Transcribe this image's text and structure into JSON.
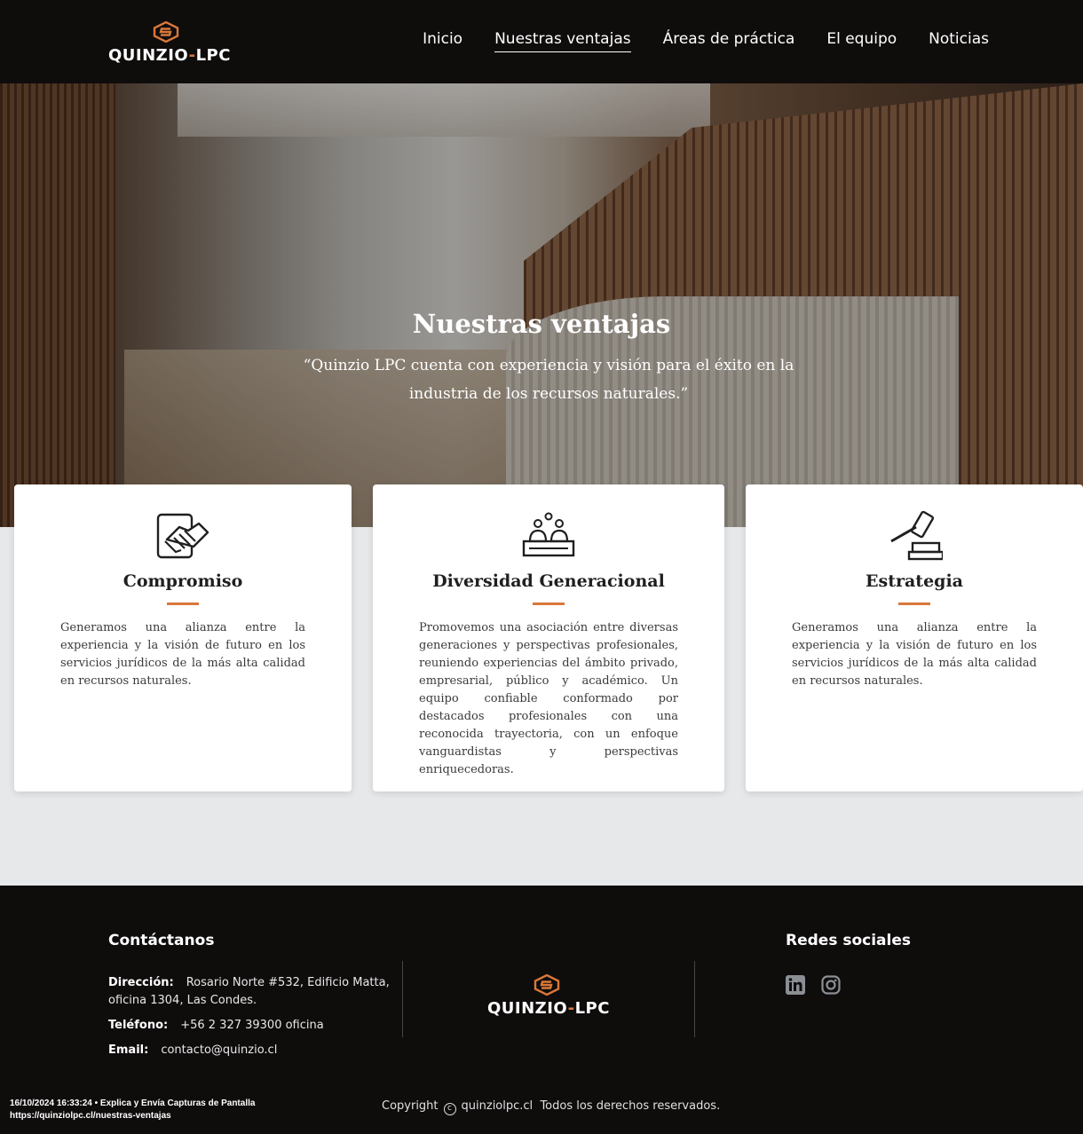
{
  "header": {
    "logo": {
      "brand": "QUINZIO",
      "separator": "-",
      "suffix": "LPC"
    },
    "nav": [
      "Inicio",
      "Nuestras ventajas",
      "Áreas de práctica",
      "El equipo",
      "Noticias"
    ],
    "active_index": 1
  },
  "hero": {
    "title": "Nuestras ventajas",
    "quote": "“Quinzio LPC cuenta con experiencia y visión para el éxito en la industria de los recursos naturales.”"
  },
  "cards": [
    {
      "icon": "handshake-icon",
      "title": "Compromiso",
      "text": "Generamos una alianza entre la experiencia y la visión de futuro en los servicios jurídicos de la más alta calidad en recursos naturales."
    },
    {
      "icon": "team-icon",
      "title": "Diversidad Generacional",
      "text": "Promovemos una asociación entre diversas generaciones y perspectivas profesionales, reuniendo experiencias del ámbito privado, empresarial, público y académico. Un equipo confiable conformado por destacados profesionales con una reconocida trayectoria, con un enfoque vanguardistas y perspectivas enriquecedoras."
    },
    {
      "icon": "gavel-icon",
      "title": "Estrategia",
      "text": "Generamos una alianza entre la experiencia y la visión de futuro en los servicios jurídicos de la más alta calidad en recursos naturales."
    }
  ],
  "footer": {
    "contact_title": "Contáctanos",
    "address_label": "Dirección:",
    "address_value": "Rosario Norte #532, Edificio Matta, oficina 1304, Las Condes.",
    "phone_label": "Teléfono:",
    "phone_value": "+56 2 327 39300 oficina",
    "email_label": "Email:",
    "email_value": "contacto@quinzio.cl",
    "social_title": "Redes sociales",
    "social_icons": [
      "linkedin-icon",
      "instagram-icon"
    ],
    "copyright_prefix": "Copyright",
    "copyright_site": "quinziolpc.cl",
    "copyright_suffix": "Todos los derechos reservados."
  },
  "stamp": {
    "line1": "16/10/2024 16:33:24 • Explica y Envía Capturas de Pantalla",
    "line2": "https://quinziolpc.cl/nuestras-ventajas"
  },
  "colors": {
    "accent": "#d9783a",
    "dark": "#0f0c0c",
    "page_bg": "#e6e8ea"
  }
}
